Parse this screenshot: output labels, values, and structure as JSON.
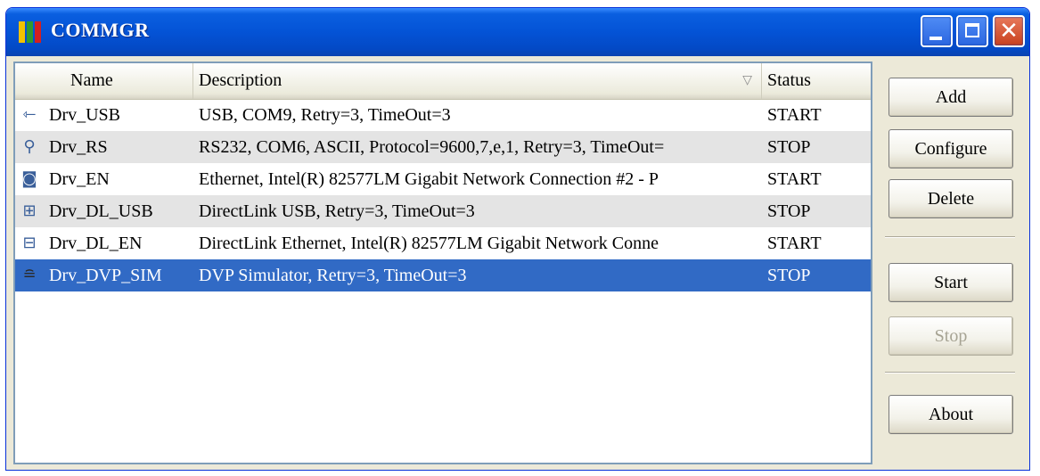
{
  "window": {
    "title": "COMMGR",
    "controls": {
      "minimize_icon": "minimize-icon",
      "maximize_icon": "maximize-icon",
      "close_glyph": "✕"
    }
  },
  "list": {
    "columns": [
      "Name",
      "Description",
      "Status"
    ],
    "sort_indicator": "▽",
    "rows": [
      {
        "icon": "⇽",
        "name": "Drv_USB",
        "description": "USB, COM9, Retry=3, TimeOut=3",
        "status": "START"
      },
      {
        "icon": "⚲",
        "name": "Drv_RS",
        "description": "RS232, COM6, ASCII, Protocol=9600,7,e,1, Retry=3, TimeOut=",
        "status": "STOP"
      },
      {
        "icon": "◙",
        "name": "Drv_EN",
        "description": "Ethernet, Intel(R) 82577LM Gigabit Network Connection #2 - P",
        "status": "START"
      },
      {
        "icon": "⊞",
        "name": "Drv_DL_USB",
        "description": "DirectLink USB, Retry=3, TimeOut=3",
        "status": "STOP"
      },
      {
        "icon": "⊟",
        "name": "Drv_DL_EN",
        "description": "DirectLink Ethernet, Intel(R) 82577LM Gigabit Network Conne",
        "status": "START"
      },
      {
        "icon": "≘",
        "name": "Drv_DVP_SIM",
        "description": "DVP Simulator, Retry=3, TimeOut=3",
        "status": "STOP"
      }
    ],
    "selected_index": 5
  },
  "buttons": {
    "add": "Add",
    "configure": "Configure",
    "delete": "Delete",
    "start": "Start",
    "stop": "Stop",
    "about": "About"
  },
  "colors": {
    "title_bar": "#0453d6",
    "selection": "#316ac5",
    "alt_row": "#e4e4e4",
    "close_button": "#c9401e",
    "app_icon": [
      "#f2c200",
      "#2f9a2f",
      "#d42020"
    ]
  }
}
